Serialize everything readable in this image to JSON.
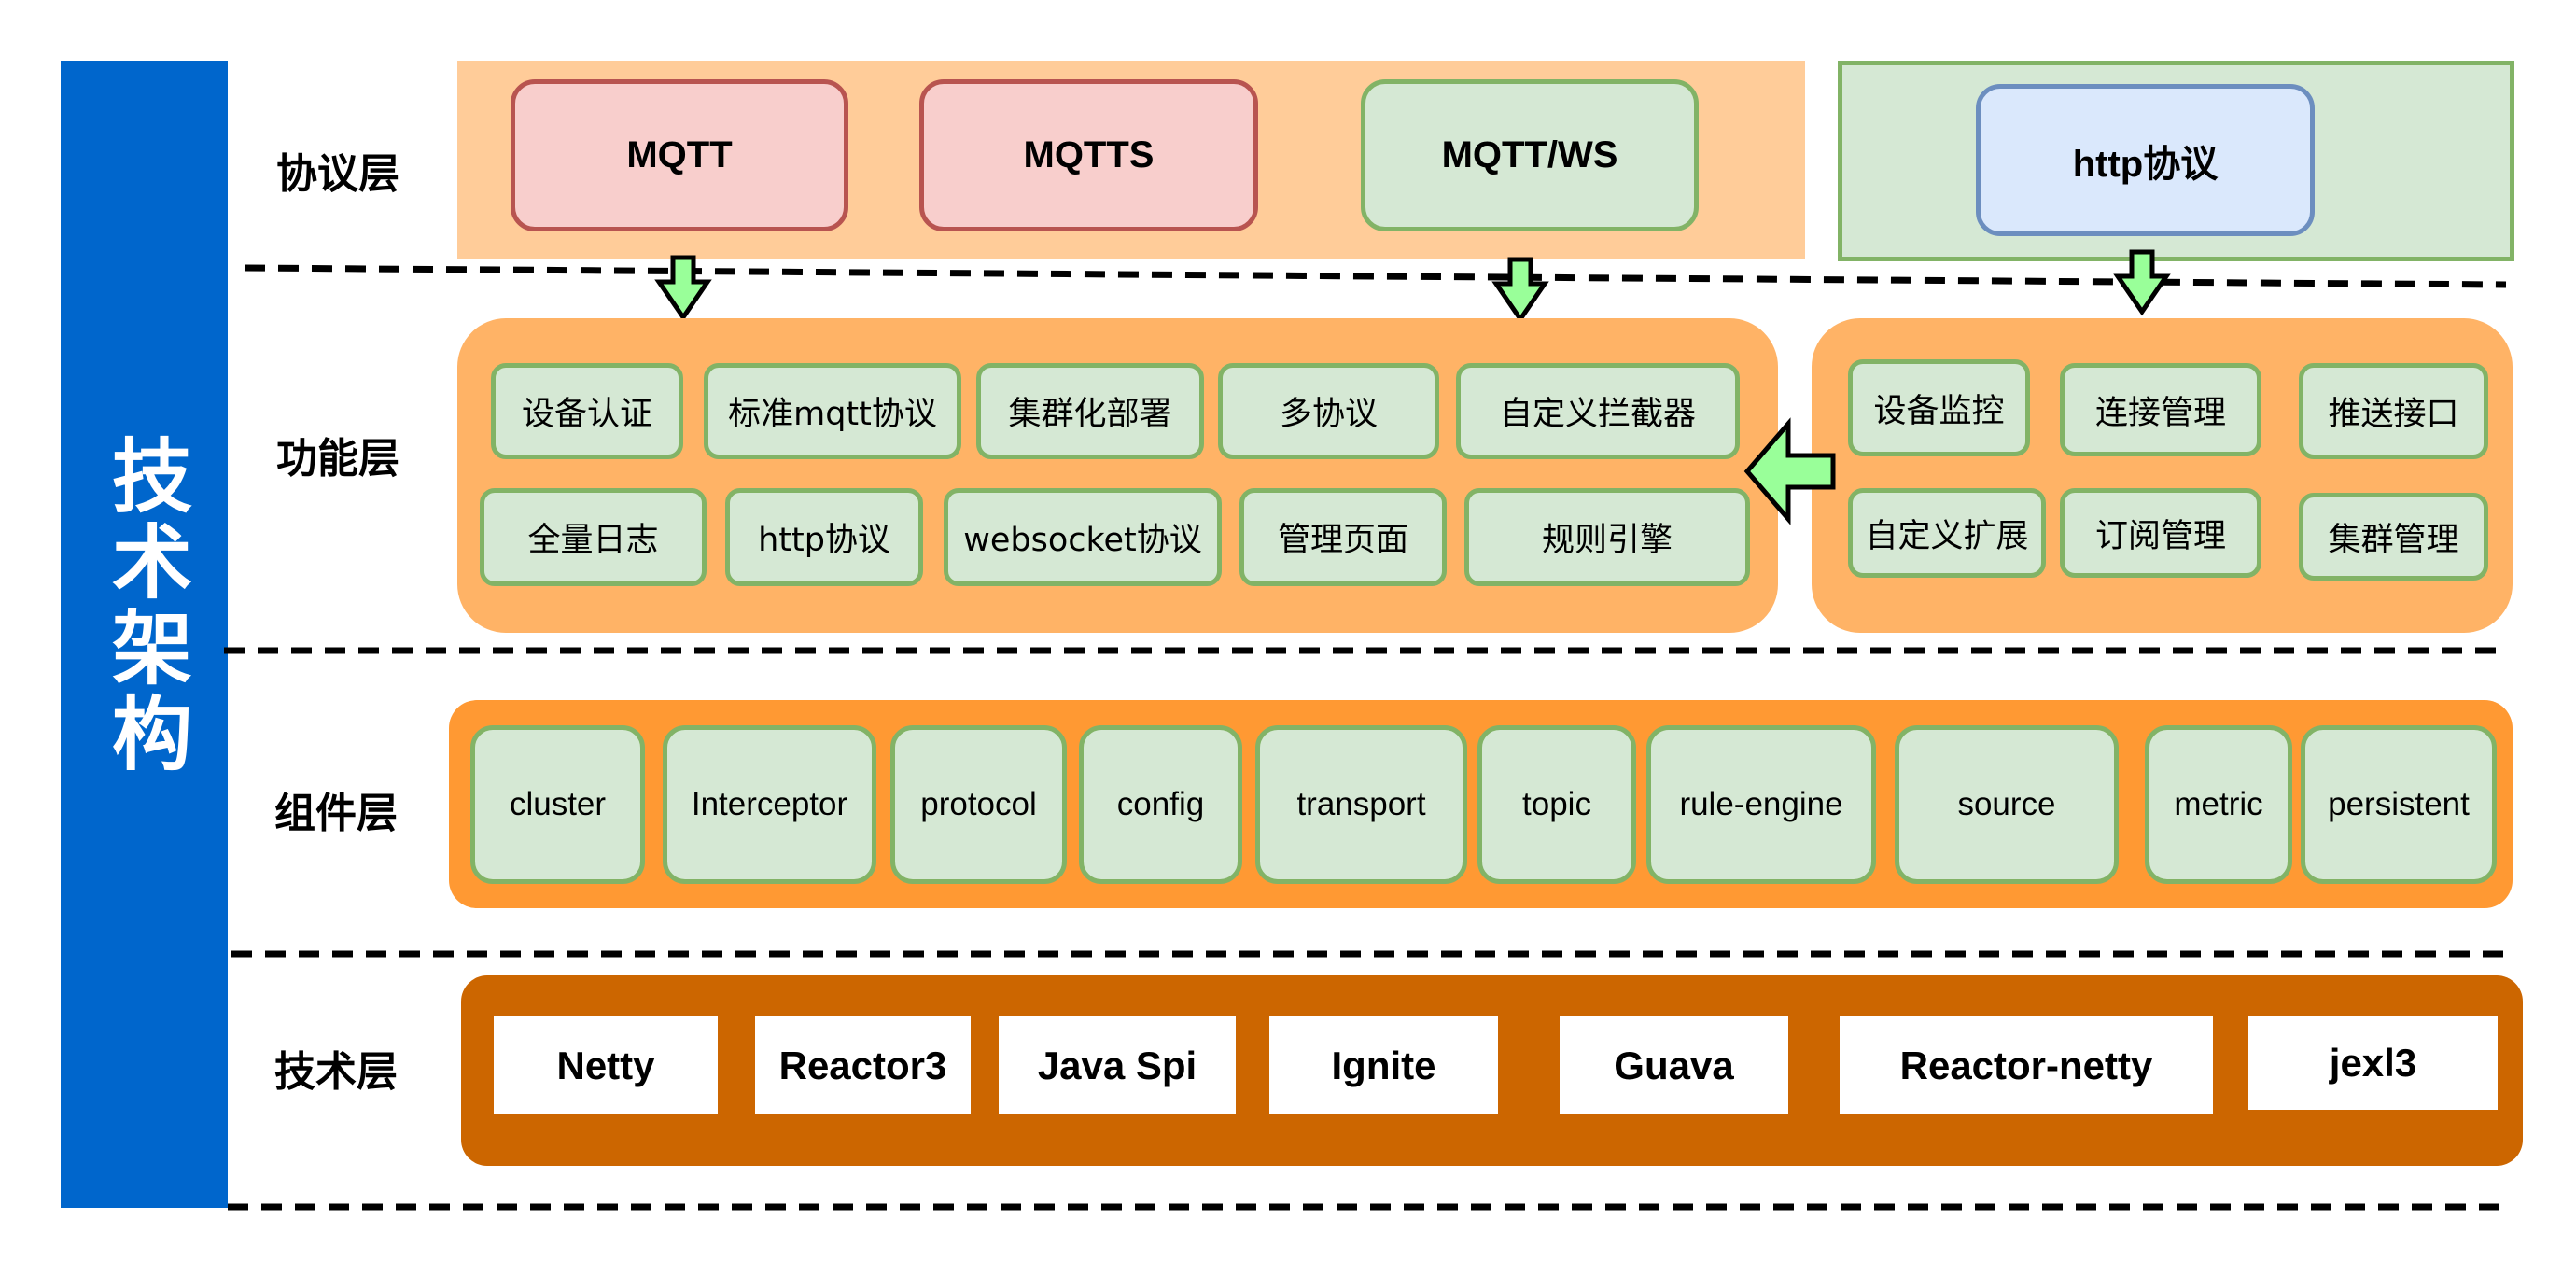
{
  "title": "技术架构",
  "layers": {
    "protocol": {
      "label": "协议层",
      "items": [
        "MQTT",
        "MQTTS",
        "MQTT/WS"
      ],
      "http_item": "http协议"
    },
    "function": {
      "label": "功能层",
      "left_row1": [
        "设备认证",
        "标准mqtt协议",
        "集群化部署",
        "多协议",
        "自定义拦截器"
      ],
      "left_row2": [
        "全量日志",
        "http协议",
        "websocket协议",
        "管理页面",
        "规则引擎"
      ],
      "right_row1": [
        "设备监控",
        "连接管理",
        "推送接口"
      ],
      "right_row2": [
        "自定义扩展",
        "订阅管理",
        "集群管理"
      ]
    },
    "component": {
      "label": "组件层",
      "items": [
        "cluster",
        "Interceptor",
        "protocol",
        "config",
        "transport",
        "topic",
        "rule-engine",
        "source",
        "metric",
        "persistent"
      ]
    },
    "technology": {
      "label": "技术层",
      "items": [
        "Netty",
        "Reactor3",
        "Java Spi",
        "Ignite",
        "Guava",
        "Reactor-netty",
        "jexl3"
      ]
    }
  },
  "colors": {
    "title_bar": "#0066CC",
    "protocol_bg": "#FFCC99",
    "function_bg": "#FFB366",
    "component_bg": "#FF9933",
    "technology_bg": "#CC6600",
    "item_green_fill": "#D5E8D4",
    "item_green_border": "#82B366",
    "item_red_fill": "#F8CECC",
    "item_red_border": "#B85450",
    "item_blue_fill": "#DAE8FC",
    "item_blue_border": "#6C8EBF",
    "arrow_fill": "#99FF99"
  }
}
